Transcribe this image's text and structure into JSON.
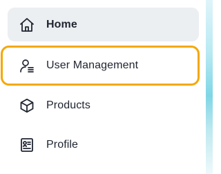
{
  "sidebar": {
    "items": [
      {
        "label": "Home",
        "icon": "home-icon",
        "active": true
      },
      {
        "label": "User Management",
        "icon": "user-list-icon",
        "focused": true
      },
      {
        "label": "Products",
        "icon": "box-icon"
      },
      {
        "label": "Profile",
        "icon": "id-card-icon"
      }
    ]
  },
  "colors": {
    "active_background": "#eceff1",
    "focus_outline": "#f5a800",
    "text": "#1f2430"
  }
}
